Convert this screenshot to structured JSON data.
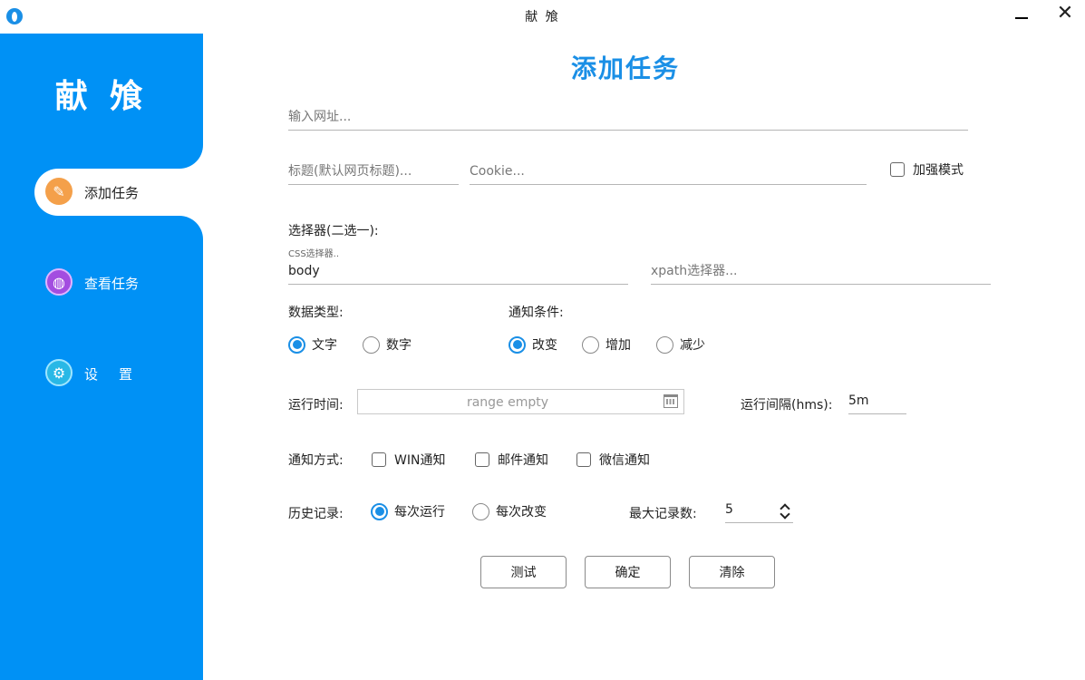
{
  "window": {
    "title": "献 飧"
  },
  "sidebar": {
    "brand": "献 飧",
    "items": [
      {
        "label": "添加任务",
        "icon": "feather-icon",
        "color": "#f4a04a",
        "active": true
      },
      {
        "label": "查看任务",
        "icon": "globe-icon",
        "color": "#a34de0",
        "active": false
      },
      {
        "label": "设　置",
        "icon": "gear-icon",
        "color": "#29b8e6",
        "active": false
      }
    ]
  },
  "main": {
    "title": "添加任务",
    "url": {
      "placeholder": "输入网址...",
      "value": ""
    },
    "title_field": {
      "placeholder": "标题(默认网页标题)...",
      "value": ""
    },
    "cookie": {
      "placeholder": "Cookie...",
      "value": ""
    },
    "enhanced_mode": {
      "label": "加强模式",
      "checked": false
    },
    "selector": {
      "label": "选择器(二选一):",
      "css_label": "CSS选择器..",
      "css_value": "body",
      "xpath_placeholder": "xpath选择器...",
      "xpath_value": ""
    },
    "data_type": {
      "label": "数据类型:",
      "options": [
        "文字",
        "数字"
      ],
      "selected": "文字"
    },
    "notify_condition": {
      "label": "通知条件:",
      "options": [
        "改变",
        "增加",
        "减少"
      ],
      "selected": "改变"
    },
    "run_time": {
      "label": "运行时间:",
      "placeholder": "range empty"
    },
    "run_interval": {
      "label": "运行间隔(hms):",
      "value": "5m"
    },
    "notify_method": {
      "label": "通知方式:",
      "options": [
        "WIN通知",
        "邮件通知",
        "微信通知"
      ],
      "checked": []
    },
    "history": {
      "label": "历史记录:",
      "options": [
        "每次运行",
        "每次改变"
      ],
      "selected": "每次运行"
    },
    "max_records": {
      "label": "最大记录数:",
      "value": "5"
    },
    "buttons": {
      "test": "测试",
      "confirm": "确定",
      "clear": "清除"
    }
  },
  "colors": {
    "sidebar": "#0091f5",
    "accent": "#1a8fe6"
  }
}
